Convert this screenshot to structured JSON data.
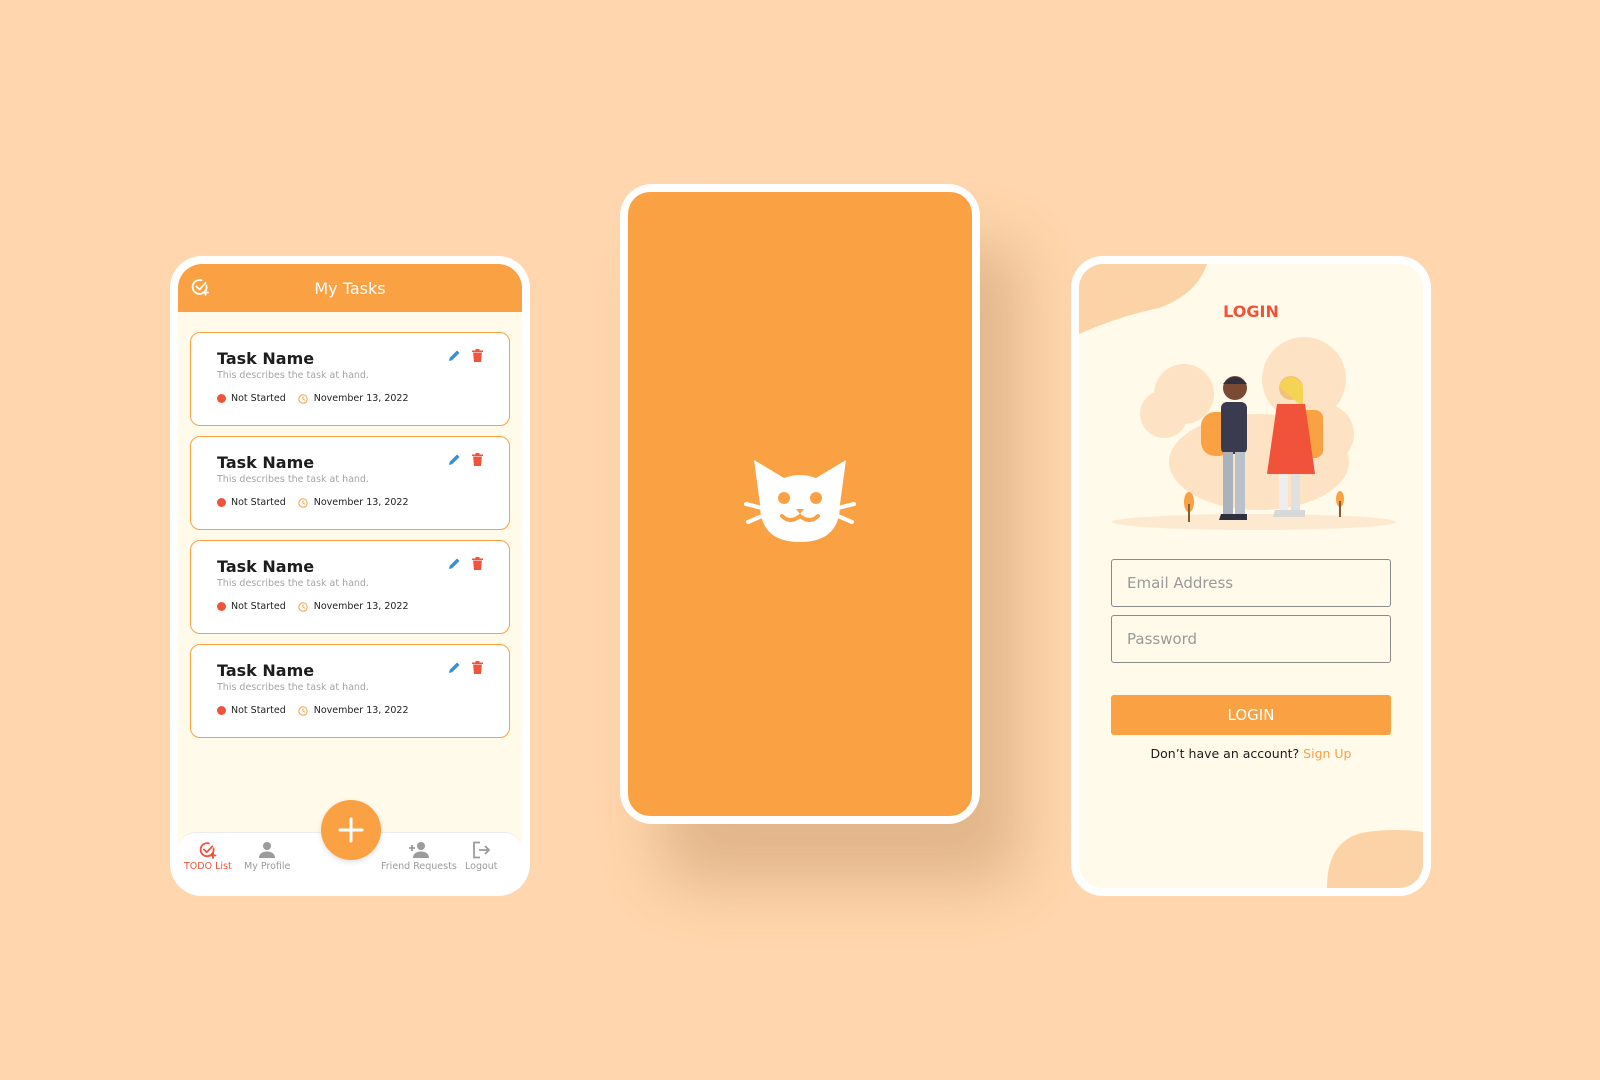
{
  "colors": {
    "background": "#ffd6ad",
    "accent": "#f9a143",
    "danger": "#f0523a",
    "edit": "#3a8fd9",
    "screen_bg": "#fffaea"
  },
  "tasks_screen": {
    "header_title": "My Tasks",
    "header_icon": "check-add-icon",
    "tasks": [
      {
        "title": "Task Name",
        "description": "This describes the task at hand.",
        "status": "Not Started",
        "date": "November 13, 2022"
      },
      {
        "title": "Task Name",
        "description": "This describes the task at hand.",
        "status": "Not Started",
        "date": "November 13, 2022"
      },
      {
        "title": "Task Name",
        "description": "This describes the task at hand.",
        "status": "Not Started",
        "date": "November 13, 2022"
      },
      {
        "title": "Task Name",
        "description": "This describes the task at hand.",
        "status": "Not Started",
        "date": "November 13, 2022"
      }
    ],
    "fab_icon": "plus-icon",
    "nav": [
      {
        "label": "TODO List",
        "icon": "check-add-icon",
        "active": true
      },
      {
        "label": "My Profile",
        "icon": "person-icon",
        "active": false
      },
      {
        "label": "Friend Requests",
        "icon": "person-add-icon",
        "active": false
      },
      {
        "label": "Logout",
        "icon": "logout-icon",
        "active": false
      }
    ]
  },
  "splash_screen": {
    "logo_icon": "cat-icon"
  },
  "login_screen": {
    "title": "LOGIN",
    "email_placeholder": "Email Address",
    "password_placeholder": "Password",
    "login_button": "LOGIN",
    "signup_prompt": "Don’t have an account?",
    "signup_link": "Sign Up"
  }
}
